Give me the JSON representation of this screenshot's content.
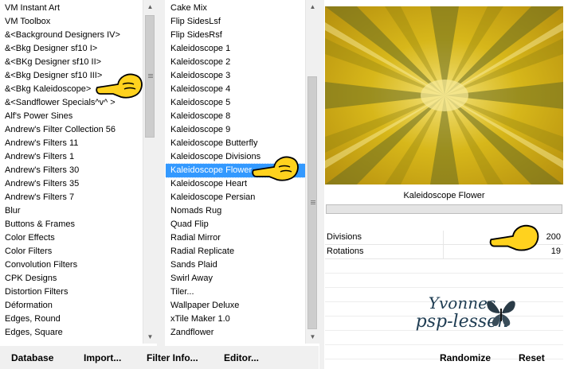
{
  "categories": [
    "VM Instant Art",
    "VM Toolbox",
    "&<Background Designers IV>",
    "&<Bkg Designer sf10 I>",
    "&<BKg Designer sf10 II>",
    "&<Bkg Designer sf10 III>",
    "&<Bkg Kaleidoscope>",
    "&<Sandflower Specials^v^ >",
    "Alf's Power Sines",
    "Andrew's Filter Collection 56",
    "Andrew's Filters 11",
    "Andrew's Filters 1",
    "Andrew's Filters 30",
    "Andrew's Filters 35",
    "Andrew's Filters 7",
    "Blur",
    "Buttons & Frames",
    "Color Effects",
    "Color Filters",
    "Convolution Filters",
    "CPK Designs",
    "Distortion Filters",
    "Déformation",
    "Edges, Round",
    "Edges, Square"
  ],
  "filters": [
    "Cake Mix",
    "Flip SidesLsf",
    "Flip SidesRsf",
    "Kaleidoscope 1",
    "Kaleidoscope 2",
    "Kaleidoscope 3",
    "Kaleidoscope 4",
    "Kaleidoscope 5",
    "Kaleidoscope 8",
    "Kaleidoscope 9",
    "Kaleidoscope Butterfly",
    "Kaleidoscope Divisions",
    "Kaleidoscope Flower",
    "Kaleidoscope Heart",
    "Kaleidoscope Persian",
    "Nomads Rug",
    "Quad Flip",
    "Radial Mirror",
    "Radial Replicate",
    "Sands Plaid",
    "Swirl Away",
    "Tiler...",
    "Wallpaper Deluxe",
    "xTile Maker 1.0",
    "Zandflower"
  ],
  "selected_filter": "Kaleidoscope Flower",
  "preview": {
    "filter_name": "Kaleidoscope Flower"
  },
  "params": [
    {
      "name": "Divisions",
      "value": "200"
    },
    {
      "name": "Rotations",
      "value": "19"
    }
  ],
  "buttons": {
    "database": "Database",
    "import": "Import...",
    "filter_info": "Filter Info...",
    "editor": "Editor...",
    "randomize": "Randomize",
    "reset": "Reset"
  },
  "watermark": {
    "line1": "Yvonnes",
    "line2": "psp-lessen"
  },
  "colors": {
    "selection": "#3399ff",
    "preview_main": "#c9aa12",
    "preview_dark": "#5f6a2a",
    "preview_light": "#f3e27a",
    "hand": "#ffd21e"
  },
  "icons": {
    "pointer": "pointing-hand-icon",
    "butterfly": "butterfly-icon"
  }
}
